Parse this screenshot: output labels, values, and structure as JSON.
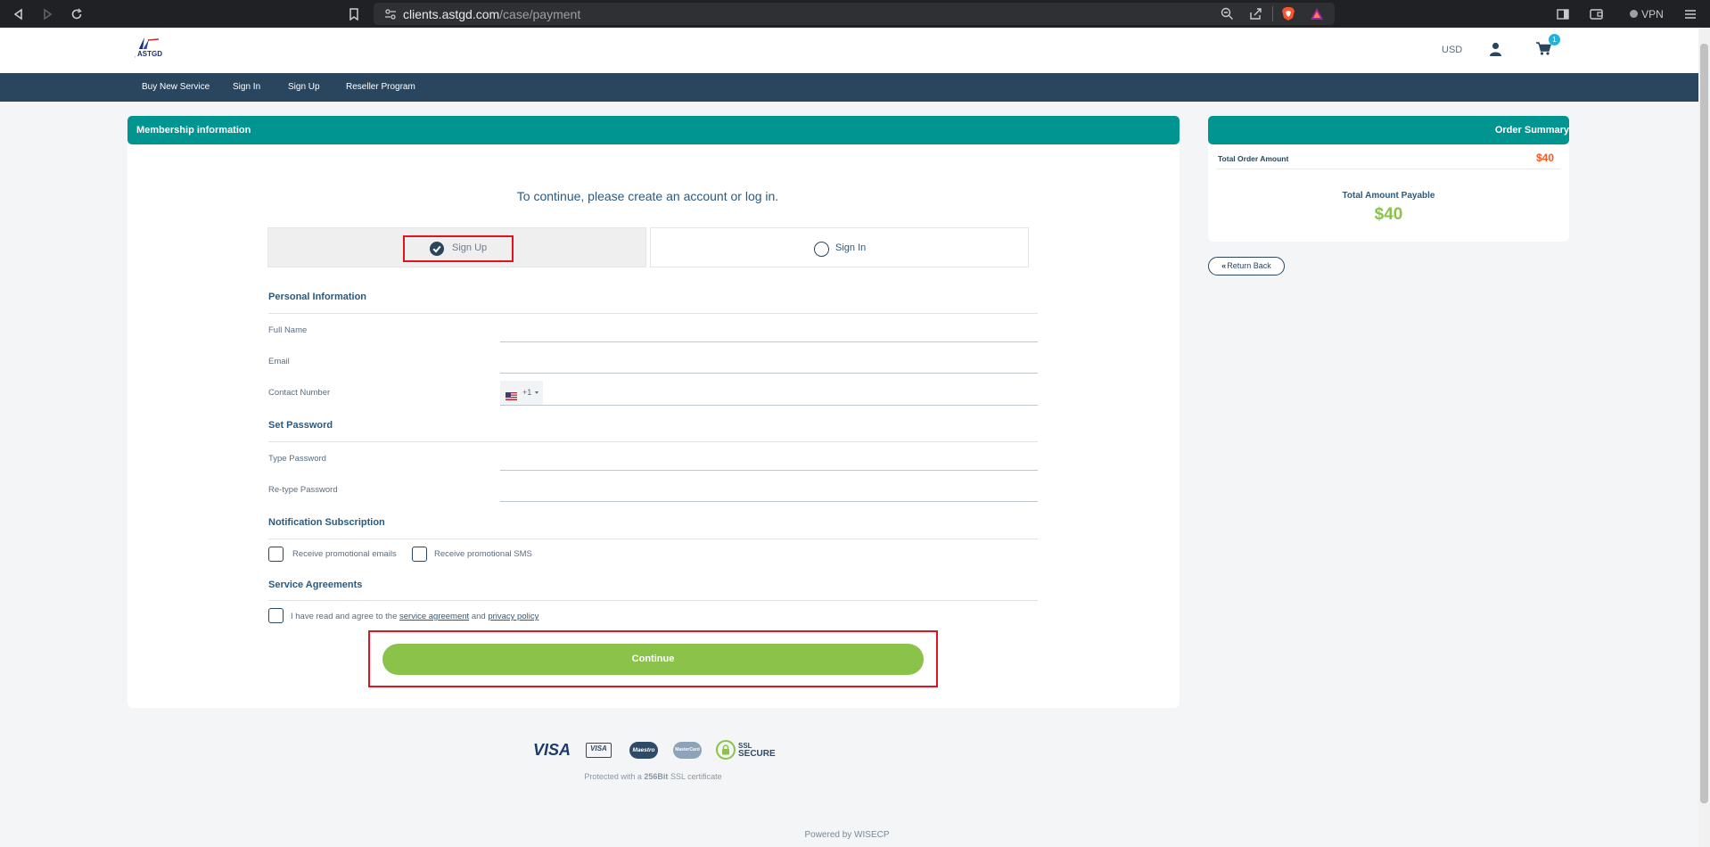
{
  "browser": {
    "url_host": "clients.astgd.com",
    "url_path": "/case/payment",
    "vpn_label": "VPN"
  },
  "header": {
    "currency": "USD",
    "cart_count": "1"
  },
  "nav": {
    "items": [
      "Buy New Service",
      "Sign In",
      "Sign Up",
      "Reseller Program"
    ]
  },
  "membership": {
    "title": "Membership information",
    "intro": "To continue, please create an account or log in.",
    "tab_signup": "Sign Up",
    "tab_signin": "Sign In",
    "personal_title": "Personal Information",
    "full_name_label": "Full Name",
    "email_label": "Email",
    "contact_label": "Contact Number",
    "phone_code": "+1",
    "password_title": "Set Password",
    "type_password_label": "Type Password",
    "retype_password_label": "Re-type Password",
    "notification_title": "Notification Subscription",
    "promo_emails": "Receive promotional emails",
    "promo_sms": "Receive promotional SMS",
    "agreements_title": "Service Agreements",
    "agree_prefix": "I have read and agree to the",
    "agree_link1": "service agreement",
    "agree_and": "and",
    "agree_link2": "privacy policy",
    "continue_label": "Continue"
  },
  "summary": {
    "title": "Order Summary",
    "total_order_label": "Total Order Amount",
    "total_order_value": "$40",
    "payable_label": "Total Amount Payable",
    "payable_value": "$40",
    "return_label": "Return Back"
  },
  "footer": {
    "payment_logos": [
      "VISA",
      "VISA",
      "Maestro",
      "MasterCard",
      "SSL",
      "SECURE"
    ],
    "ssl_note_prefix": "Protected with a",
    "ssl_note_bold": "256Bit",
    "ssl_note_suffix": "SSL certificate",
    "powered_by": "Powered by WISECP"
  },
  "colors": {
    "teal": "#009591",
    "navy": "#2a465e",
    "green": "#8bc34a",
    "orange": "#ff5722",
    "highlight": "#e0141e"
  }
}
